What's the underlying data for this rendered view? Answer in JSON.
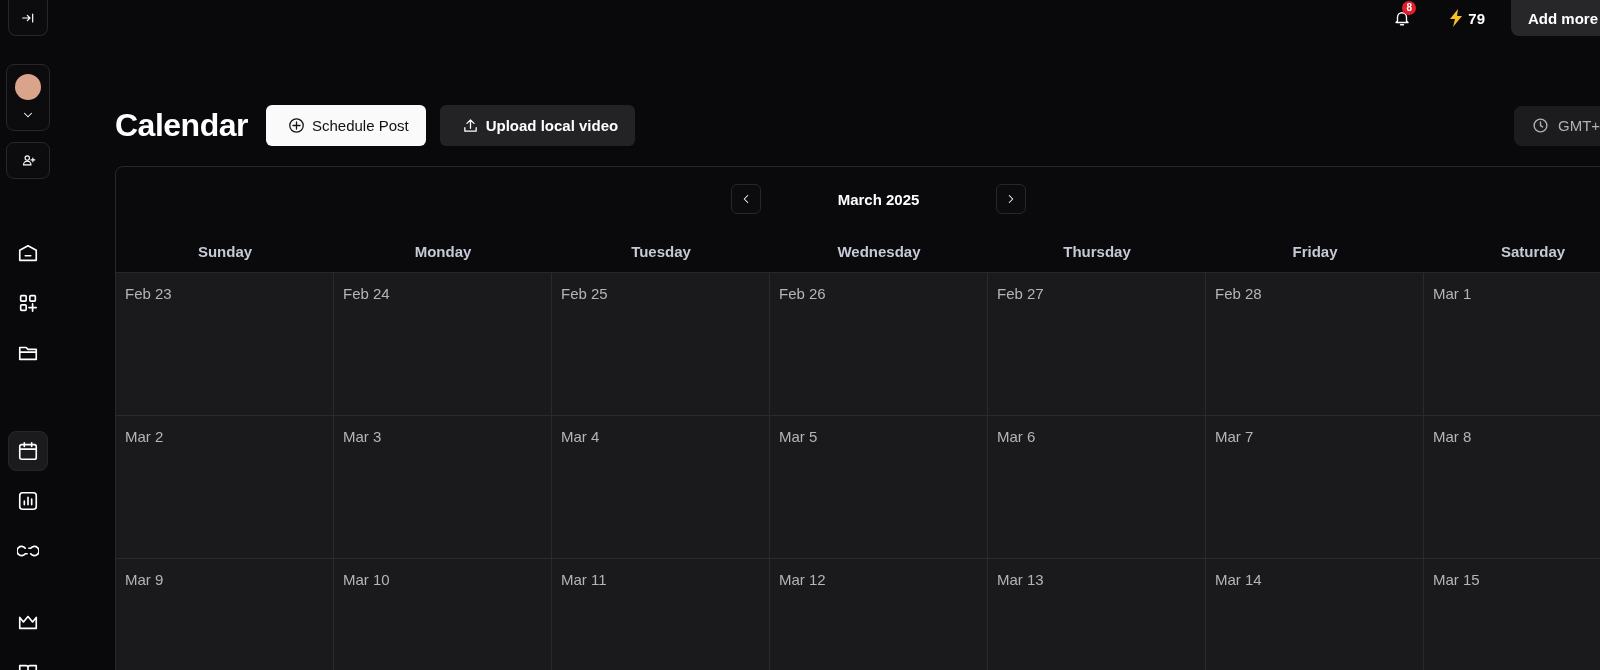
{
  "sidebar": {
    "nav": [
      {
        "selected": false
      },
      {
        "selected": false
      },
      {
        "selected": false
      },
      {
        "selected": true
      },
      {
        "selected": false
      },
      {
        "selected": false
      },
      {
        "selected": false
      },
      {
        "selected": false
      }
    ]
  },
  "topbar": {
    "notification_count": "8",
    "credits": "79",
    "add_more_button": "Add more"
  },
  "header": {
    "title": "Calendar",
    "buttons": [
      {
        "label": "Schedule Post",
        "kind": "primary"
      },
      {
        "label": "Upload local video",
        "kind": "secondary"
      }
    ],
    "timezone": "GMT+"
  },
  "calendar": {
    "month": "March 2025",
    "weekdays": [
      "Sunday",
      "Monday",
      "Tuesday",
      "Wednesday",
      "Thursday",
      "Friday",
      "Saturday"
    ],
    "weeks": [
      [
        "Feb 23",
        "Feb 24",
        "Feb 25",
        "Feb 26",
        "Feb 27",
        "Feb 28",
        "Mar 1"
      ],
      [
        "Mar 2",
        "Mar 3",
        "Mar 4",
        "Mar 5",
        "Mar 6",
        "Mar 7",
        "Mar 8"
      ],
      [
        "Mar 9",
        "Mar 10",
        "Mar 11",
        "Mar 12",
        "Mar 13",
        "Mar 14",
        "Mar 15"
      ]
    ]
  }
}
